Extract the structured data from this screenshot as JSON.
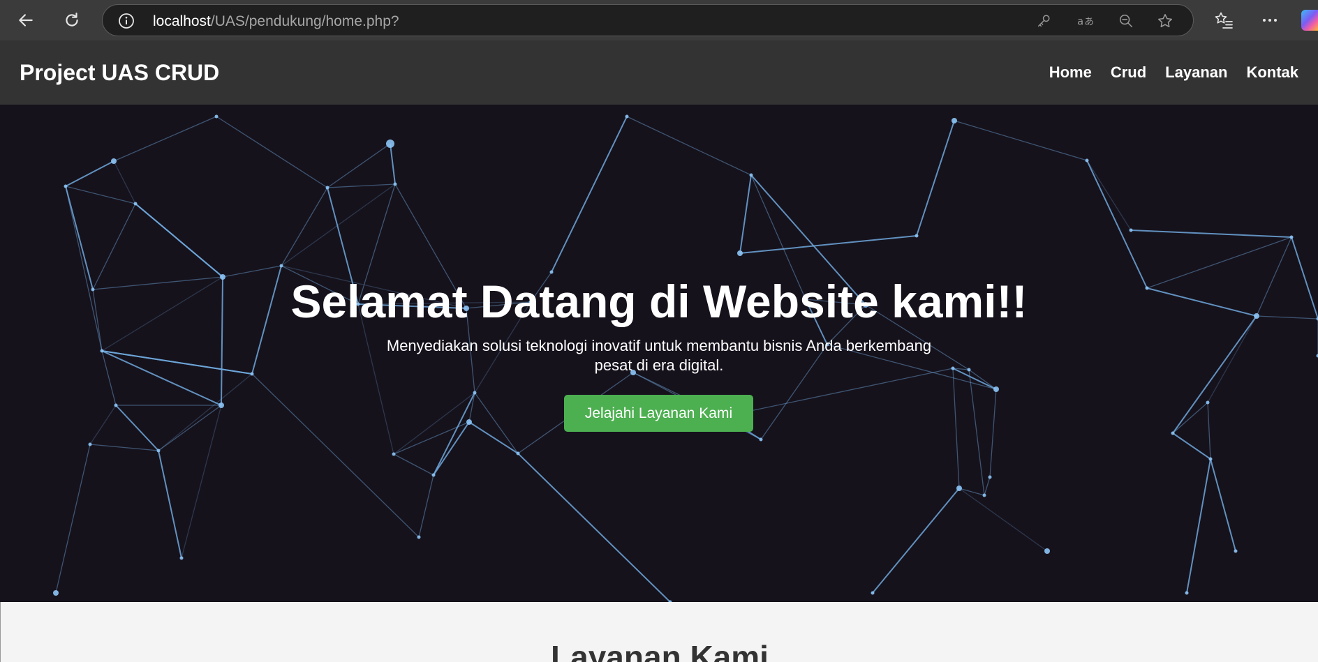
{
  "browser": {
    "url_host": "localhost",
    "url_path": "/UAS/pendukung/home.php?",
    "icons": [
      "back-icon",
      "refresh-icon",
      "info-icon",
      "key-icon",
      "translate-icon",
      "zoom-out-icon",
      "favorite-star-icon",
      "favorites-list-icon",
      "more-icon"
    ]
  },
  "navbar": {
    "brand": "Project UAS CRUD",
    "items": [
      {
        "label": "Home"
      },
      {
        "label": "Crud"
      },
      {
        "label": "Layanan"
      },
      {
        "label": "Kontak"
      }
    ]
  },
  "hero": {
    "title": "Selamat Datang di Website kami!!",
    "subtitle": "Menyediakan solusi teknologi inovatif untuk membantu bisnis Anda berkembang pesat di era digital.",
    "button_label": "Jelajahi Layanan Kami",
    "button_color": "#4caf50",
    "background_color": "#16121c",
    "network_color": "#6fa8dc"
  },
  "services": {
    "title": "Layanan Kami"
  }
}
